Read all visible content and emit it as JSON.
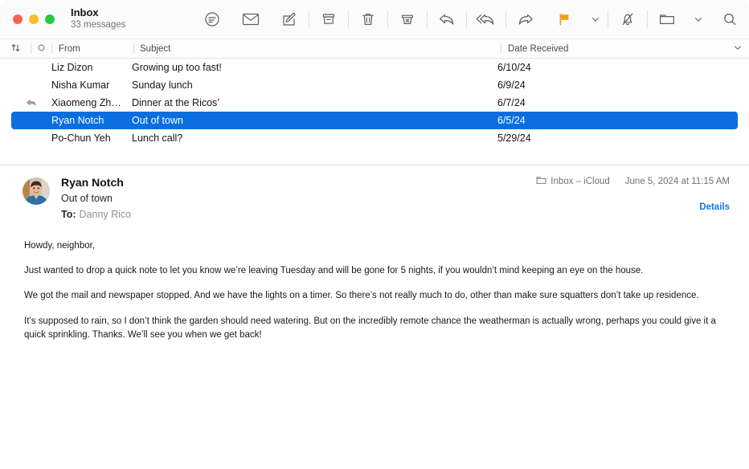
{
  "window": {
    "traffic_lights": [
      "close",
      "minimize",
      "maximize"
    ]
  },
  "toolbar": {
    "mailbox_name": "Inbox",
    "message_count": "33 messages",
    "buttons": [
      {
        "name": "filter-button",
        "icon": "filter-icon"
      },
      {
        "name": "get-mail-button",
        "icon": "envelope-icon"
      },
      {
        "name": "compose-button",
        "icon": "compose-icon"
      },
      {
        "name": "archive-button",
        "icon": "archive-icon"
      },
      {
        "name": "delete-button",
        "icon": "trash-icon"
      },
      {
        "name": "junk-button",
        "icon": "junk-icon"
      },
      {
        "name": "reply-button",
        "icon": "reply-icon"
      },
      {
        "name": "reply-all-button",
        "icon": "reply-all-icon"
      },
      {
        "name": "forward-button",
        "icon": "forward-icon"
      },
      {
        "name": "flag-button",
        "icon": "flag-icon"
      },
      {
        "name": "flag-menu-button",
        "icon": "chevron-down-icon"
      },
      {
        "name": "mute-button",
        "icon": "bell-slash-icon"
      },
      {
        "name": "move-button",
        "icon": "folder-icon"
      },
      {
        "name": "move-menu-button",
        "icon": "chevron-down-icon"
      },
      {
        "name": "search-button",
        "icon": "search-icon"
      }
    ],
    "flag_color": "#f59b16"
  },
  "list_header": {
    "sort_icon": "sort-arrows-icon",
    "unread_icon": "unread-circle-icon",
    "from": "From",
    "subject": "Subject",
    "date_received": "Date Received",
    "options_icon": "chevron-down-icon"
  },
  "messages": [
    {
      "replied": false,
      "from": "Liz Dizon",
      "subject": "Growing up too fast!",
      "date": "6/10/24",
      "selected": false
    },
    {
      "replied": false,
      "from": "Nisha Kumar",
      "subject": "Sunday lunch",
      "date": "6/9/24",
      "selected": false
    },
    {
      "replied": true,
      "from": "Xiaomeng Zh…",
      "subject": "Dinner at the Ricos’",
      "date": "6/7/24",
      "selected": false
    },
    {
      "replied": false,
      "from": "Ryan Notch",
      "subject": "Out of town",
      "date": "6/5/24",
      "selected": true
    },
    {
      "replied": false,
      "from": "Po-Chun Yeh",
      "subject": "Lunch call?",
      "date": "5/29/24",
      "selected": false
    }
  ],
  "selection_color": "#0b6ee0",
  "message": {
    "sender": "Ryan Notch",
    "subject": "Out of town",
    "to_label": "To:",
    "to_value": "Danny Rico",
    "mailbox": "Inbox – iCloud",
    "mailbox_icon": "folder-icon",
    "date": "June 5, 2024 at 11:15 AM",
    "details_label": "Details",
    "details_color": "#1575e6",
    "avatar": "contact-photo",
    "body": [
      "Howdy, neighbor,",
      "Just wanted to drop a quick note to let you know we’re leaving Tuesday and will be gone for 5 nights, if you wouldn’t mind keeping an eye on the house.",
      "We got the mail and newspaper stopped. And we have the lights on a timer. So there’s not really much to do, other than make sure squatters don’t take up residence.",
      "It’s supposed to rain, so I don’t think the garden should need watering. But on the incredibly remote chance the weatherman is actually wrong, perhaps you could give it a quick sprinkling. Thanks. We’ll see you when we get back!"
    ]
  }
}
